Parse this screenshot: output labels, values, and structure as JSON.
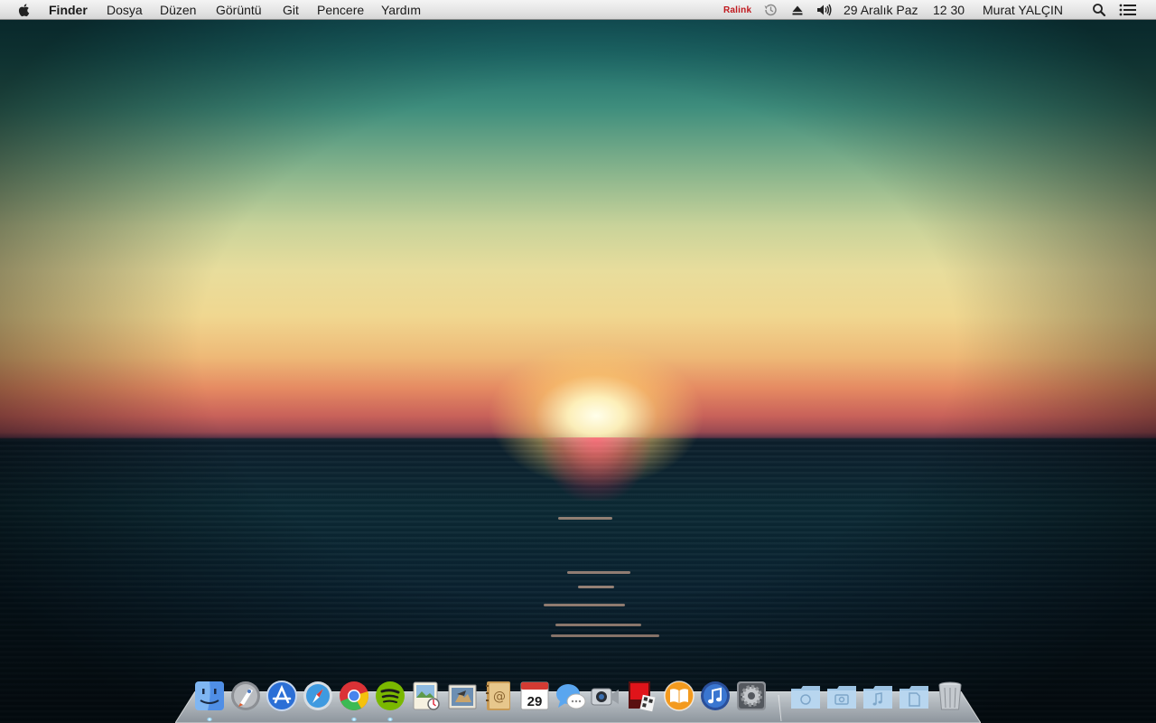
{
  "menubar": {
    "app_name": "Finder",
    "menus": [
      "Dosya",
      "Düzen",
      "Görüntü",
      "Git",
      "Pencere",
      "Yardım"
    ],
    "status": {
      "wifi_vendor": "Ralink",
      "date": "29 Aralık Paz",
      "time": "12 30",
      "user": "Murat YALÇIN"
    },
    "icons": [
      "apple-icon",
      "time-machine-icon",
      "eject-icon",
      "volume-icon",
      "spotlight-icon",
      "notification-center-icon"
    ]
  },
  "dock": {
    "apps": [
      {
        "name": "finder-icon",
        "running": true
      },
      {
        "name": "launchpad-icon",
        "running": false
      },
      {
        "name": "app-store-icon",
        "running": false
      },
      {
        "name": "safari-icon",
        "running": false
      },
      {
        "name": "chrome-icon",
        "running": true
      },
      {
        "name": "spotify-icon",
        "running": true
      },
      {
        "name": "preview-icon",
        "running": false
      },
      {
        "name": "mail-icon",
        "running": false
      },
      {
        "name": "contacts-icon",
        "running": false
      },
      {
        "name": "calendar-icon",
        "running": false
      },
      {
        "name": "messages-icon",
        "running": false
      },
      {
        "name": "facetime-icon",
        "running": false
      },
      {
        "name": "photo-booth-icon",
        "running": false
      },
      {
        "name": "ibooks-icon",
        "running": false
      },
      {
        "name": "itunes-icon",
        "running": false
      },
      {
        "name": "system-preferences-icon",
        "running": false
      }
    ],
    "calendar_day": "29",
    "stacks": [
      "applications-folder-icon",
      "pictures-folder-icon",
      "music-folder-icon",
      "documents-folder-icon"
    ],
    "trash": "trash-icon",
    "colors": {
      "finder_blue": "#4f8ee6",
      "chrome_red": "#db3236",
      "chrome_green": "#3cba54",
      "chrome_yellow": "#f4c20d",
      "spotify_green": "#7ab800",
      "ibooks_orange": "#f39a1e"
    }
  }
}
